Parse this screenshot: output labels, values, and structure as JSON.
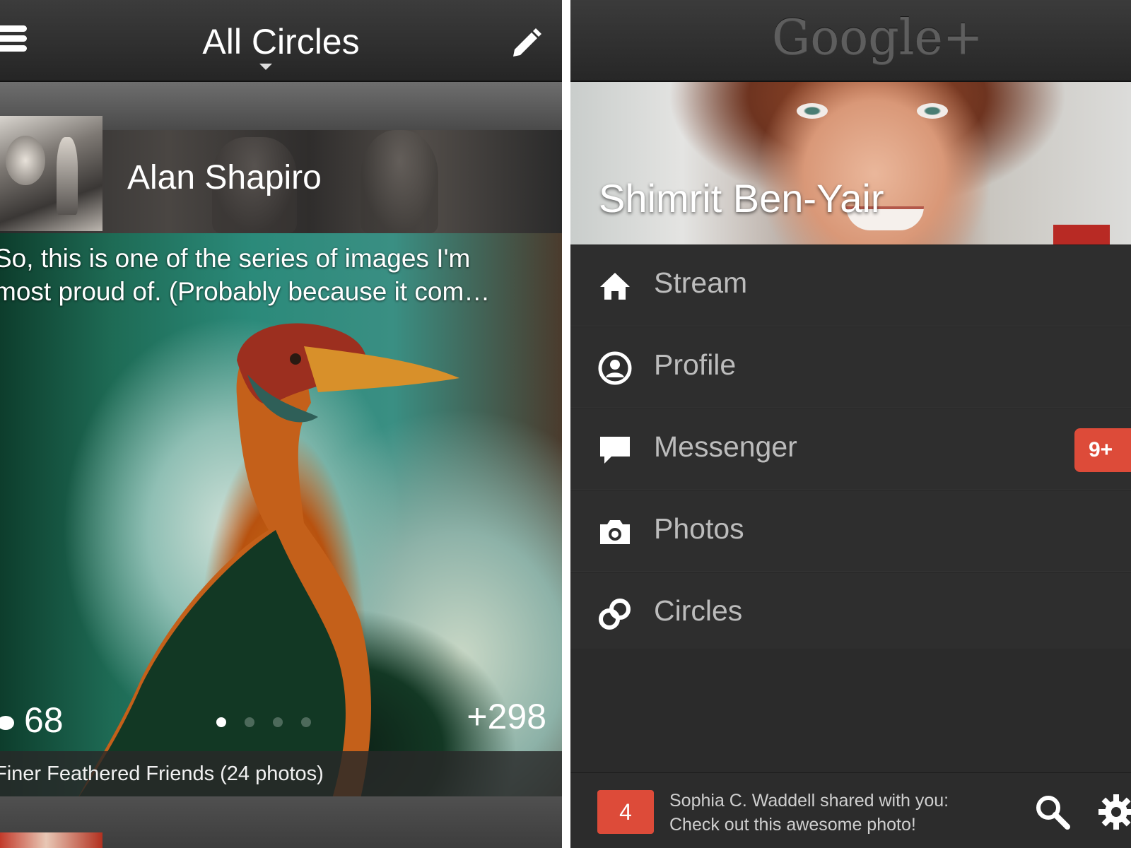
{
  "left": {
    "header": {
      "title": "All Circles"
    },
    "post": {
      "author": "Alan Shapiro",
      "text_line1": "So, this is one of the series of images I'm",
      "text_line2": "most proud of. (Probably because it com…",
      "comments": "68",
      "plus_ones": "+298",
      "album": "Finer Feathered Friends (24 photos)"
    }
  },
  "right": {
    "header": {
      "brand": "Google+"
    },
    "profile": {
      "name": "Shimrit Ben-Yair"
    },
    "nav": [
      {
        "label": "Stream",
        "icon": "home-icon"
      },
      {
        "label": "Profile",
        "icon": "profile-icon"
      },
      {
        "label": "Messenger",
        "icon": "chat-icon",
        "badge": "9+"
      },
      {
        "label": "Photos",
        "icon": "camera-icon"
      },
      {
        "label": "Circles",
        "icon": "circles-icon"
      }
    ],
    "notification": {
      "count": "4",
      "line1": "Sophia C. Waddell shared with you:",
      "line2": "Check out this awesome photo!"
    }
  },
  "colors": {
    "badge_red": "#dd4b39",
    "nav_bg": "#2e2e2e",
    "topbar": "#2a2a2a"
  }
}
